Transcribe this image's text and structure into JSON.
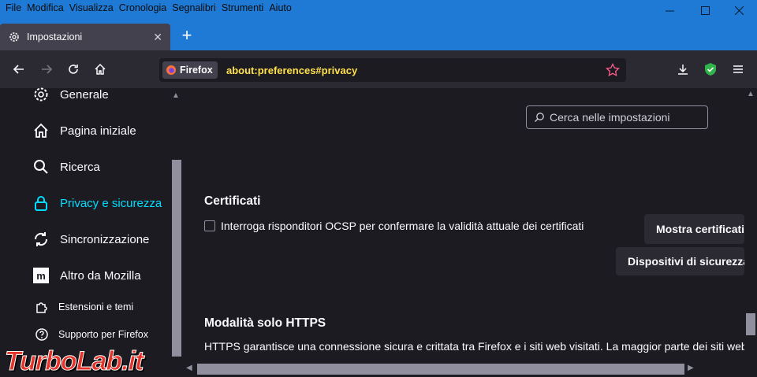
{
  "menubar": {
    "items": [
      {
        "label": "File"
      },
      {
        "label": "Modifica"
      },
      {
        "label": "Visualizza"
      },
      {
        "label": "Cronologia"
      },
      {
        "label": "Segnalibri"
      },
      {
        "label": "Strumenti"
      },
      {
        "label": "Aiuto"
      }
    ]
  },
  "window_controls": {
    "minimize": "—",
    "maximize": "☐",
    "close": "✕"
  },
  "tab": {
    "title": "Impostazioni",
    "close": "✕"
  },
  "new_tab": "+",
  "urlbar": {
    "identity_label": "Firefox",
    "url": "about:preferences#privacy"
  },
  "sidebar": {
    "items": [
      {
        "label": "Generale",
        "icon": "gear-icon"
      },
      {
        "label": "Pagina iniziale",
        "icon": "home-icon"
      },
      {
        "label": "Ricerca",
        "icon": "search-icon"
      },
      {
        "label": "Privacy e sicurezza",
        "icon": "lock-icon",
        "selected": true
      },
      {
        "label": "Sincronizzazione",
        "icon": "sync-icon"
      },
      {
        "label": "Altro da Mozilla",
        "icon": "mozilla-icon"
      },
      {
        "label": "Estensioni e temi",
        "icon": "puzzle-icon"
      },
      {
        "label": "Supporto per Firefox",
        "icon": "help-icon"
      }
    ]
  },
  "search": {
    "placeholder": "Cerca nelle impostazioni"
  },
  "certificates": {
    "title": "Certificati",
    "ocsp_label": "Interroga risponditori OCSP per confermare la validità attuale dei certificati",
    "ocsp_checked": false,
    "view_button": "Mostra certificati",
    "devices_button": "Dispositivi di sicurezza"
  },
  "https_only": {
    "title": "Modalità solo HTTPS",
    "description": "HTTPS garantisce una connessione sicura e crittata tra Firefox e i siti web visitati. La maggior parte dei siti web supporta HTTPS e, se la modalità solo HTTPS è attiva, Firefox farà in modo che tutte le connessioni avvengano tramite HTTPS."
  },
  "watermark": "TurboLab.it",
  "colors": {
    "titlebar": "#1f7ad6",
    "toolbar": "#2b2a33",
    "background": "#1c1b22",
    "selected": "#00ddff",
    "url_highlight": "#ffe14d"
  }
}
